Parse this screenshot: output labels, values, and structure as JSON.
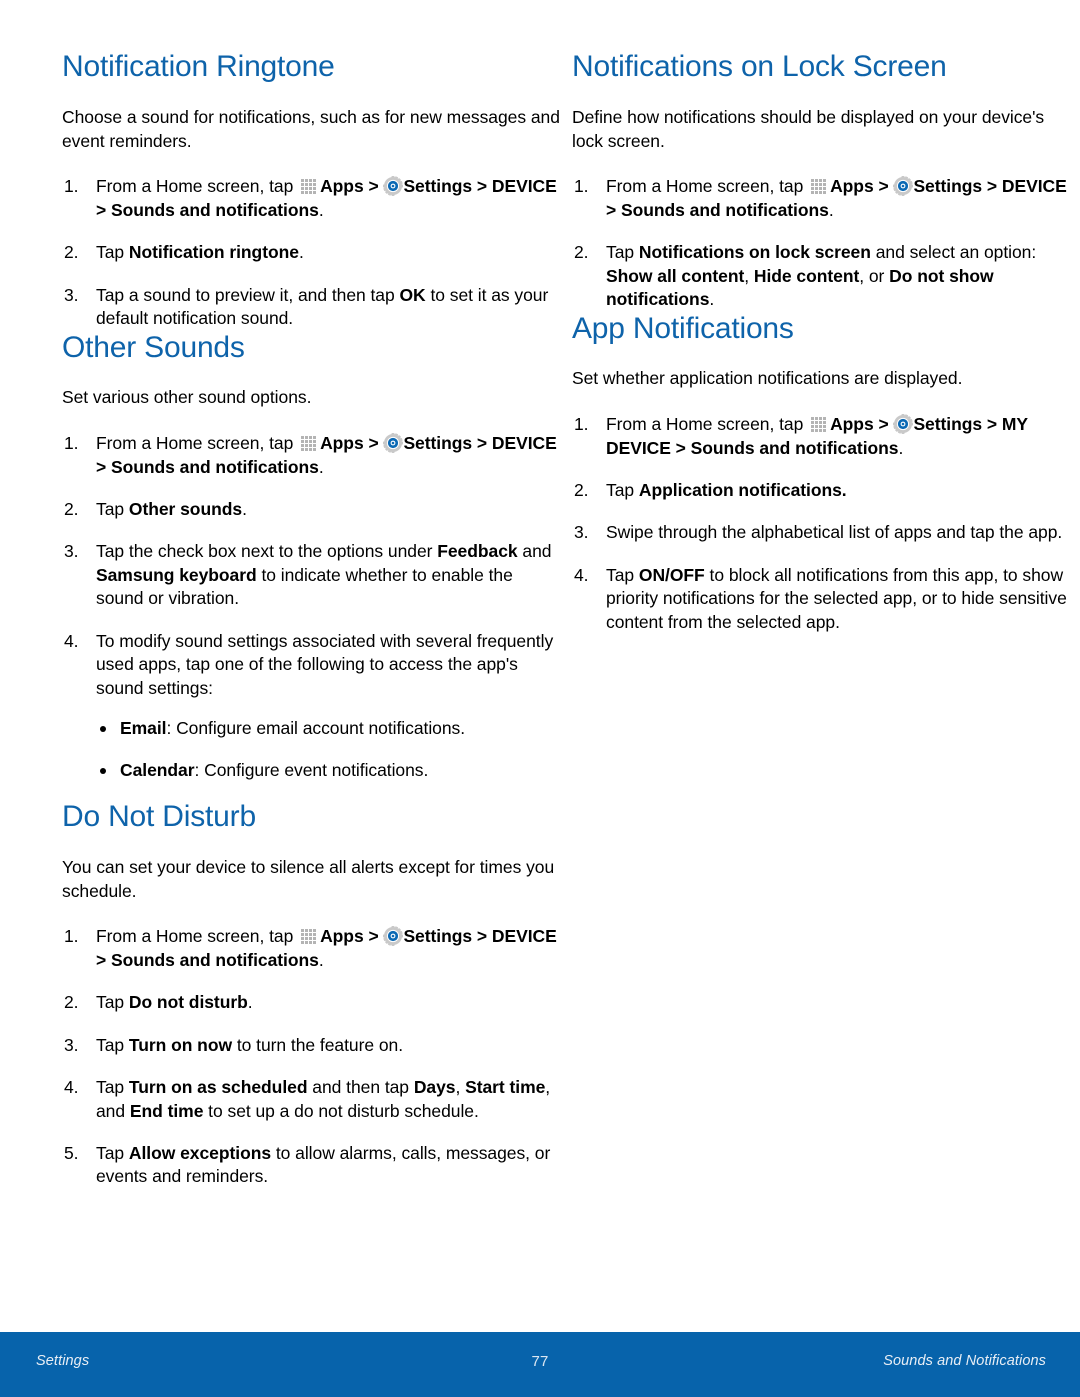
{
  "page": {
    "number": "77",
    "footer_left": "Settings",
    "footer_right": "Sounds and Notifications",
    "accent_color": "#0e63aa",
    "footer_color": "#0763ab"
  },
  "icons": {
    "apps": "apps-grid-icon",
    "settings": "gear-icon"
  },
  "left_column": {
    "sections": [
      {
        "heading": "Notification Ringtone",
        "intro": "Choose a sound for notifications, such as for new messages and event reminders.",
        "steps": [
          {
            "num": "1.",
            "prefix": "From a Home screen, tap ",
            "apps_label": "Apps",
            "sep1": " > ",
            "settings_label": "Settings",
            "path": " > DEVICE > Sounds and notifications",
            "suffix": "."
          },
          {
            "num": "2.",
            "plain_before": "Tap ",
            "bold": "Notification ringtone",
            "plain_after": "."
          },
          {
            "num": "3.",
            "plain_before": "Tap a sound to preview it, and then tap ",
            "bold": "OK",
            "plain_after": " to set it as your default notification sound."
          }
        ]
      },
      {
        "heading": "Other Sounds",
        "intro": "Set various other sound options.",
        "steps": [
          {
            "num": "1.",
            "prefix": "From a Home screen, tap ",
            "apps_label": "Apps",
            "sep1": " > ",
            "settings_label": "Settings",
            "path": " > DEVICE > Sounds and notifications",
            "suffix": "."
          },
          {
            "num": "2.",
            "plain_before": "Tap ",
            "bold": "Other sounds",
            "plain_after": "."
          },
          {
            "num": "3.",
            "plain_before": "Tap the check box next to the options under ",
            "bold": "Feedback",
            "mid": " and ",
            "bold2": "Samsung keyboard",
            "plain_after": " to indicate whether to enable the sound or vibration."
          },
          {
            "num": "4.",
            "plain_before": "To modify sound settings associated with several frequently used apps, tap one of the following to access the app's sound settings:",
            "bullets": [
              {
                "bold": "Email",
                "rest": ": Configure email account notifications."
              },
              {
                "bold": "Calendar",
                "rest": ": Configure event notifications."
              }
            ]
          }
        ]
      },
      {
        "heading": "Do Not Disturb",
        "intro": "You can set your device to silence all alerts except for times you schedule.",
        "steps": [
          {
            "num": "1.",
            "prefix": "From a Home screen, tap ",
            "apps_label": "Apps",
            "sep1": " > ",
            "settings_label": "Settings",
            "path": " > DEVICE > Sounds and notifications",
            "suffix": "."
          },
          {
            "num": "2.",
            "plain_before": "Tap ",
            "bold": "Do not disturb",
            "plain_after": "."
          },
          {
            "num": "3.",
            "plain_before": "Tap ",
            "bold": "Turn on now",
            "plain_after": " to turn the feature on."
          },
          {
            "num": "4.",
            "plain_before": "Tap ",
            "bold": "Turn on as scheduled",
            "mid": " and then tap ",
            "bold2": "Days",
            "mid2": ", ",
            "bold3": "Start time",
            "mid3": ", and ",
            "bold4": "End time",
            "plain_after": " to set up a do not disturb schedule."
          },
          {
            "num": "5.",
            "plain_before": "Tap ",
            "bold": "Allow exceptions",
            "plain_after": " to allow alarms, calls, messages, or events and reminders."
          }
        ]
      }
    ]
  },
  "right_column": {
    "sections": [
      {
        "heading": "Notifications on Lock Screen",
        "intro": "Define how notifications should be displayed on your device's lock screen.",
        "steps": [
          {
            "num": "1.",
            "prefix": "From a Home screen, tap ",
            "apps_label": "Apps",
            "sep1": " > ",
            "settings_label": "Settings",
            "path": " > DEVICE > Sounds and notifications",
            "suffix": "."
          },
          {
            "num": "2.",
            "plain_before": "Tap ",
            "bold": "Notifications on lock screen",
            "mid": " and select an option: ",
            "bold2": "Show all content",
            "mid2": ", ",
            "bold3": "Hide content",
            "mid3": ", or ",
            "bold4": "Do not show notifications",
            "plain_after": "."
          }
        ]
      },
      {
        "heading": "App Notifications",
        "intro": "Set whether application notifications are displayed.",
        "steps": [
          {
            "num": "1.",
            "prefix": "From a Home screen, tap ",
            "apps_label": "Apps",
            "sep1": " > ",
            "settings_label": "Settings",
            "path": " > MY DEVICE > Sounds and notifications",
            "suffix": "."
          },
          {
            "num": "2.",
            "plain_before": "Tap ",
            "bold": "Application notifications.",
            "plain_after": ""
          },
          {
            "num": "3.",
            "plain_before": "Swipe through the alphabetical list of apps and tap the app."
          },
          {
            "num": "4.",
            "plain_before": "Tap ",
            "bold": "ON/OFF",
            "plain_after": " to block all notifications from this app, to show priority notifications for the selected app, or to hide sensitive content from the selected app."
          }
        ]
      }
    ]
  }
}
